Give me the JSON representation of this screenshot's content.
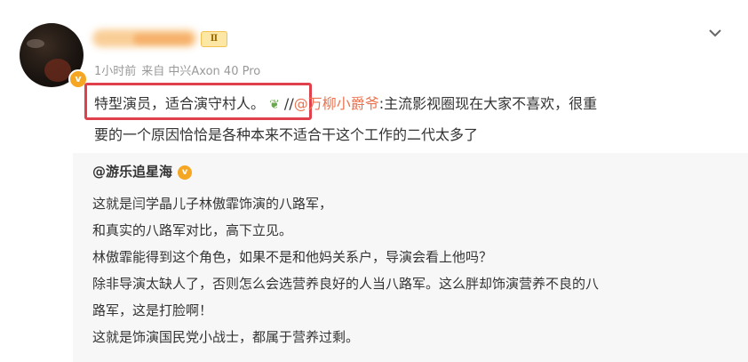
{
  "post": {
    "verified_badge": "v",
    "level_badge": "Ⅱ",
    "time": "1小时前",
    "source": "来自 中兴Axon 40 Pro",
    "highlighted_text": "特型演员，适合演守村人。",
    "emoji_icon": "leaf-emoji-icon",
    "repost_prefix": " //",
    "mention": "@万柳小爵爷",
    "comment_line1": ":主流影视圈现在大家不喜欢，很重",
    "comment_line2": "要的一个原因恰恰是各种本来不适合干这个工作的二代太多了",
    "menu_icon": "chevron-down-icon",
    "highlight_color": "#e0404c"
  },
  "retweet": {
    "author": "@游乐追星海",
    "author_badge": "v",
    "lines": [
      "这就是闫学晶儿子林傲霏饰演的八路军，",
      "和真实的八路军对比，高下立见。",
      "林傲霏能得到这个角色，如果不是和他妈关系户，导演会看上他吗？",
      "除非导演太缺人了，否则怎么会选营养良好的人当八路军。这么胖却饰演营养不良的八",
      "路军，这是打脸啊！",
      "这就是饰演国民党小战士，都属于营养过剩。"
    ]
  }
}
